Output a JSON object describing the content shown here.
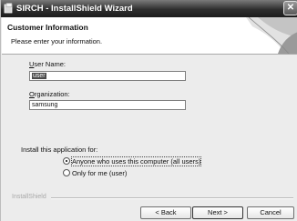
{
  "window": {
    "title": "SIRCH - InstallShield Wizard",
    "close_glyph": "✕"
  },
  "header": {
    "title": "Customer Information",
    "subtitle": "Please enter your information."
  },
  "fields": {
    "user_name": {
      "label_accel": "U",
      "label_rest": "ser Name:",
      "value": "user"
    },
    "organization": {
      "label_accel": "O",
      "label_rest": "rganization:",
      "value": "samsung"
    }
  },
  "install_for": {
    "label": "Install this application for:",
    "options": [
      {
        "label": "Anyone who uses this computer (all users)",
        "checked": true
      },
      {
        "label": "Only for me (user)",
        "checked": false
      }
    ]
  },
  "brand": "InstallShield",
  "buttons": {
    "back": "< Back",
    "next": "Next >",
    "cancel": "Cancel"
  },
  "icons": [
    "app-icon",
    "close-icon",
    "header-art"
  ]
}
